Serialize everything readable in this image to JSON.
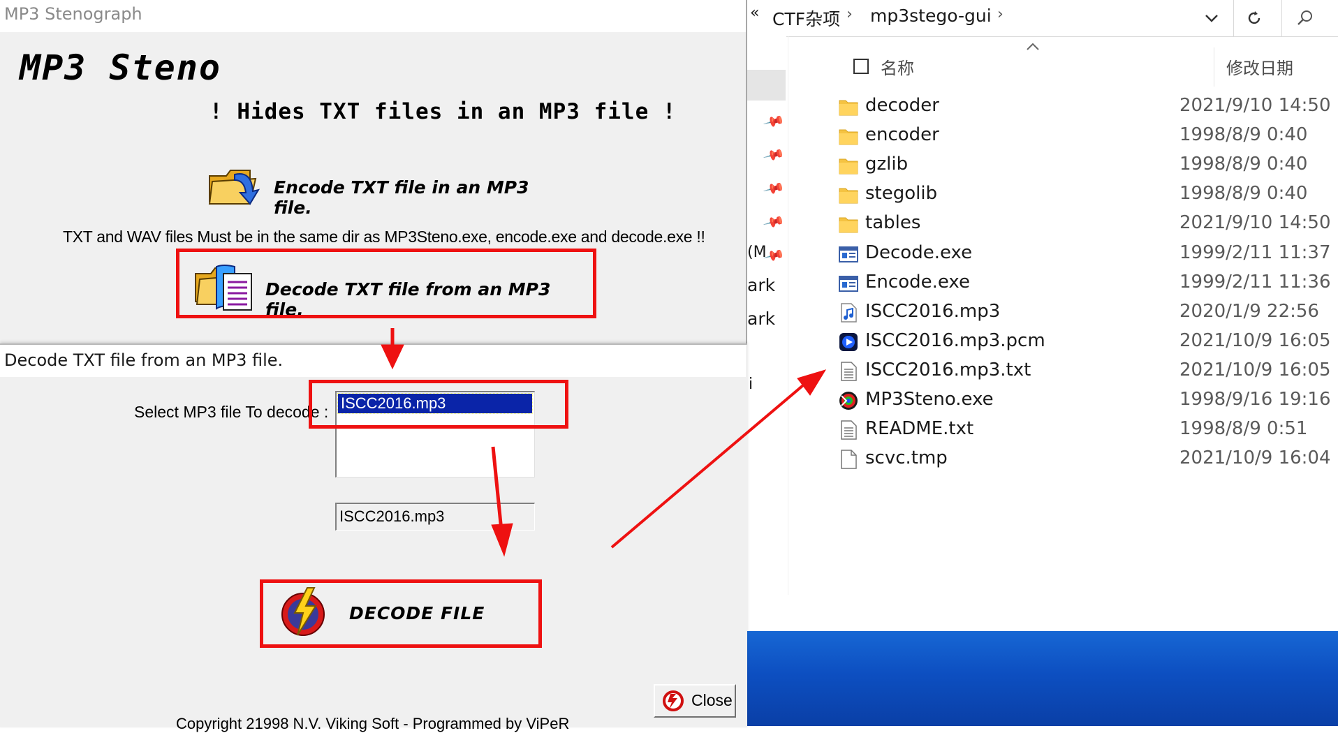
{
  "steno_window": {
    "title": "MP3 Stenograph",
    "logo": "MP3 Steno",
    "tagline": "! Hides TXT files in an MP3 file !",
    "encode_label": "Encode TXT file in an MP3 file.",
    "note": "TXT and WAV files Must be in the same dir as MP3Steno.exe, encode.exe and decode.exe !!",
    "decode_label": "Decode TXT file from an MP3 file."
  },
  "decode_dialog": {
    "title": "Decode TXT file from an MP3 file.",
    "select_label": "Select MP3 file To decode :",
    "list_items": [
      "ISCC2016.mp3"
    ],
    "file_field": "ISCC2016.mp3",
    "decode_button": "DECODE FILE",
    "close_button": "Close",
    "copyright": "Copyright 21998 N.V. Viking Soft - Programmed by ViPeR"
  },
  "explorer": {
    "breadcrumb_prefix": "«",
    "breadcrumb": [
      "CTF杂项",
      "mp3stego-gui"
    ],
    "nav_fragments": [
      "(M",
      "ark",
      "ark",
      "i"
    ],
    "columns": {
      "name": "名称",
      "date": "修改日期"
    },
    "files": [
      {
        "name": "decoder",
        "date": "2021/9/10 14:50",
        "icon": "folder-icon"
      },
      {
        "name": "encoder",
        "date": "1998/8/9 0:40",
        "icon": "folder-icon"
      },
      {
        "name": "gzlib",
        "date": "1998/8/9 0:40",
        "icon": "folder-icon"
      },
      {
        "name": "stegolib",
        "date": "1998/8/9 0:40",
        "icon": "folder-icon"
      },
      {
        "name": "tables",
        "date": "2021/9/10 14:50",
        "icon": "folder-icon"
      },
      {
        "name": "Decode.exe",
        "date": "1999/2/11 11:37",
        "icon": "exe-icon"
      },
      {
        "name": "Encode.exe",
        "date": "1999/2/11 11:36",
        "icon": "exe-icon"
      },
      {
        "name": "ISCC2016.mp3",
        "date": "2020/1/9 22:56",
        "icon": "audio-file-icon"
      },
      {
        "name": "ISCC2016.mp3.pcm",
        "date": "2021/10/9 16:05",
        "icon": "media-player-icon"
      },
      {
        "name": "ISCC2016.mp3.txt",
        "date": "2021/10/9 16:05",
        "icon": "text-file-icon"
      },
      {
        "name": "MP3Steno.exe",
        "date": "1998/9/16 19:16",
        "icon": "mp3steno-app-icon"
      },
      {
        "name": "README.txt",
        "date": "1998/8/9 0:51",
        "icon": "text-file-icon"
      },
      {
        "name": "scvc.tmp",
        "date": "2021/10/9 16:04",
        "icon": "blank-file-icon"
      }
    ]
  },
  "colors": {
    "annotation": "#ee1111",
    "selection": "#0a24a8",
    "desktop": "#0d4fc1",
    "folder": "#f5c342"
  }
}
